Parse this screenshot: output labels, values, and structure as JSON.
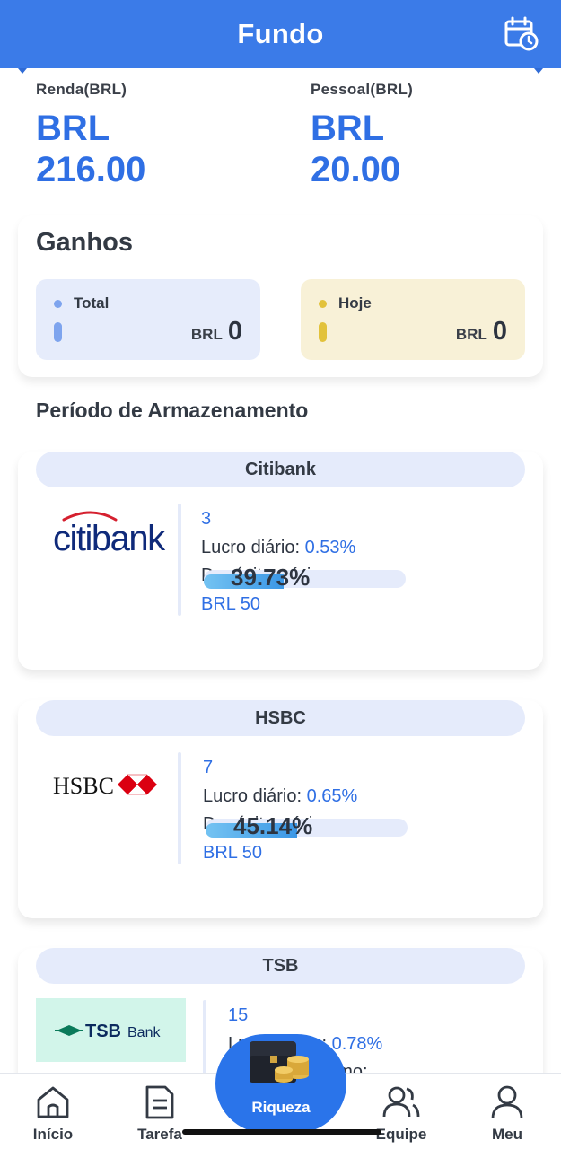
{
  "header": {
    "title": "Fundo",
    "calendar_icon": "calendar-clock-icon"
  },
  "income": {
    "renda": {
      "label": "Renda(BRL)",
      "currency": "BRL",
      "value": "216.00"
    },
    "pessoal": {
      "label": "Pessoal(BRL)",
      "currency": "BRL",
      "value": "20.00"
    }
  },
  "earnings": {
    "title": "Ganhos",
    "total": {
      "label": "Total",
      "currency": "BRL",
      "value": "0",
      "dot_color": "#7ea4ee",
      "bar_color": "#7ea4ee"
    },
    "today": {
      "label": "Hoje",
      "currency": "BRL",
      "value": "0",
      "dot_color": "#e2c23b",
      "bar_color": "#e2c23b"
    }
  },
  "storage": {
    "title": "Período de Armazenamento",
    "banks": [
      {
        "name": "Citibank",
        "logo_text": "citibank",
        "days": "3",
        "profit_label": "Lucro diário:",
        "profit_value": "0.53%",
        "min_label": "Depósito mínimo:",
        "min_value": "BRL 50",
        "progress": 0.3973,
        "progress_label": "39.73%"
      },
      {
        "name": "HSBC",
        "logo_text": "HSBC",
        "days": "7",
        "profit_label": "Lucro diário:",
        "profit_value": "0.65%",
        "min_label": "Depósito mínimo:",
        "min_value": "BRL 50",
        "progress": 0.4514,
        "progress_label": "45.14%"
      },
      {
        "name": "TSB",
        "logo_text": "TSB",
        "logo_suffix": "Bank",
        "days": "15",
        "profit_label": "Lucro diário:",
        "profit_value": "0.78%",
        "min_label": "Depósito mínimo:"
      }
    ]
  },
  "nav": {
    "items": [
      {
        "label": "Início",
        "icon": "home-icon"
      },
      {
        "label": "Tarefa",
        "icon": "document-icon"
      },
      {
        "label": "Riqueza",
        "icon": "treasure-chest-icon"
      },
      {
        "label": "Equipe",
        "icon": "team-icon"
      },
      {
        "label": "Meu",
        "icon": "user-icon"
      }
    ]
  },
  "colors": {
    "primary": "#3b7be8",
    "accent_blue": "#2f6fe4",
    "pill_bg": "#e5ebfb"
  }
}
